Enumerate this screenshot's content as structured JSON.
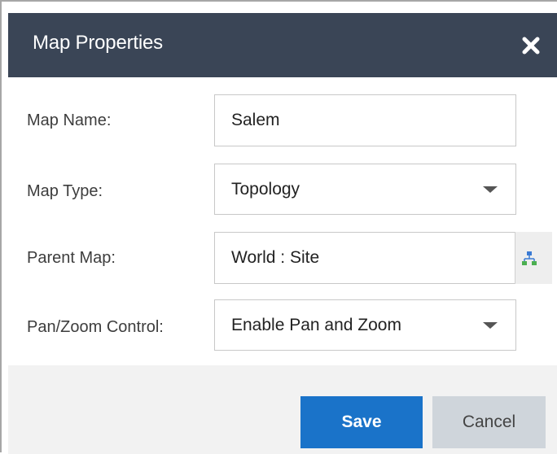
{
  "dialog": {
    "title": "Map Properties"
  },
  "form": {
    "map_name": {
      "label": "Map Name:",
      "value": "Salem"
    },
    "map_type": {
      "label": "Map Type:",
      "value": "Topology"
    },
    "parent_map": {
      "label": "Parent Map:",
      "value": "World : Site"
    },
    "pan_zoom": {
      "label": "Pan/Zoom Control:",
      "value": "Enable Pan and Zoom"
    }
  },
  "buttons": {
    "save": "Save",
    "cancel": "Cancel"
  },
  "icons": {
    "close": "close-icon",
    "parent_picker": "map-tree-icon",
    "dropdown": "chevron-down-icon"
  },
  "colors": {
    "header_bg": "#3a4556",
    "save_bg": "#1a73c9",
    "cancel_bg": "#cfd5db",
    "footer_bg": "#f2f2f2"
  }
}
